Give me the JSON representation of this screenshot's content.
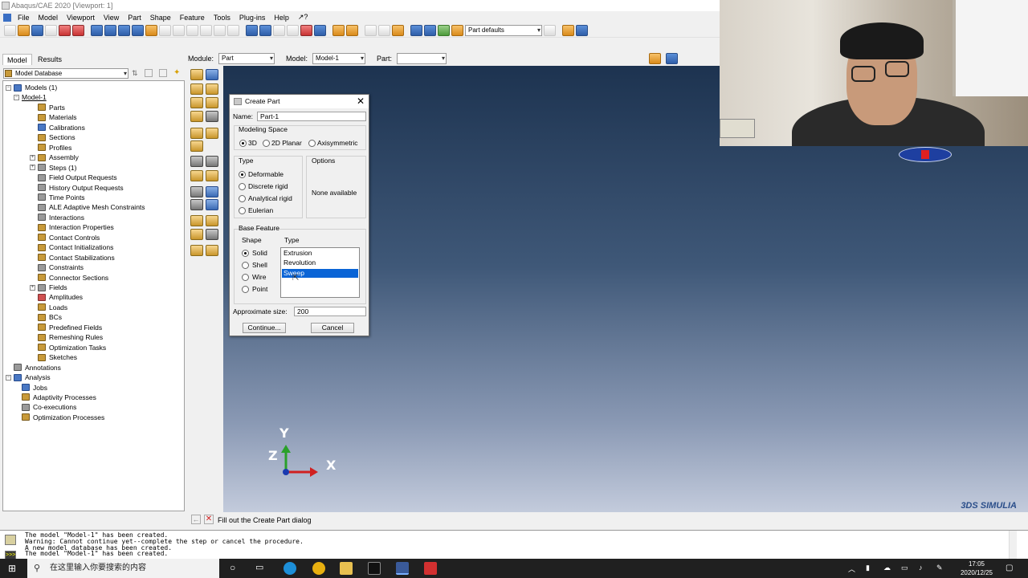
{
  "window": {
    "title": "Abaqus/CAE 2020 [Viewport: 1]"
  },
  "menu": [
    "File",
    "Model",
    "Viewport",
    "View",
    "Part",
    "Shape",
    "Feature",
    "Tools",
    "Plug-ins",
    "Help",
    "↗?"
  ],
  "toolbar": {
    "part_defaults": "Part defaults"
  },
  "tree_tabs": [
    "Model",
    "Results"
  ],
  "context": {
    "module_label": "Module:",
    "module_value": "Part",
    "model_label": "Model:",
    "model_value": "Model-1",
    "part_label": "Part:",
    "part_value": ""
  },
  "tree_combo": "Model Database",
  "tree": [
    {
      "label": "Models (1)",
      "indent": 0,
      "exp": "−",
      "icon": "blue"
    },
    {
      "label": "Model-1",
      "indent": 1,
      "exp": "−",
      "icon": "none",
      "underline": true
    },
    {
      "label": "Parts",
      "indent": 2,
      "icon": "orange"
    },
    {
      "label": "Materials",
      "indent": 2,
      "icon": "orange"
    },
    {
      "label": "Calibrations",
      "indent": 2,
      "icon": "blue"
    },
    {
      "label": "Sections",
      "indent": 2,
      "icon": "orange"
    },
    {
      "label": "Profiles",
      "indent": 2,
      "icon": "orange"
    },
    {
      "label": "Assembly",
      "indent": 2,
      "exp": "+",
      "icon": "orange"
    },
    {
      "label": "Steps (1)",
      "indent": 2,
      "exp": "+",
      "icon": "gray"
    },
    {
      "label": "Field Output Requests",
      "indent": 2,
      "icon": "gray"
    },
    {
      "label": "History Output Requests",
      "indent": 2,
      "icon": "gray"
    },
    {
      "label": "Time Points",
      "indent": 2,
      "icon": "gray"
    },
    {
      "label": "ALE Adaptive Mesh Constraints",
      "indent": 2,
      "icon": "gray"
    },
    {
      "label": "Interactions",
      "indent": 2,
      "icon": "gray"
    },
    {
      "label": "Interaction Properties",
      "indent": 2,
      "icon": "orange"
    },
    {
      "label": "Contact Controls",
      "indent": 2,
      "icon": "orange"
    },
    {
      "label": "Contact Initializations",
      "indent": 2,
      "icon": "orange"
    },
    {
      "label": "Contact Stabilizations",
      "indent": 2,
      "icon": "orange"
    },
    {
      "label": "Constraints",
      "indent": 2,
      "icon": "gray"
    },
    {
      "label": "Connector Sections",
      "indent": 2,
      "icon": "orange"
    },
    {
      "label": "Fields",
      "indent": 2,
      "exp": "+",
      "icon": "gray"
    },
    {
      "label": "Amplitudes",
      "indent": 2,
      "icon": "red"
    },
    {
      "label": "Loads",
      "indent": 2,
      "icon": "orange"
    },
    {
      "label": "BCs",
      "indent": 2,
      "icon": "orange"
    },
    {
      "label": "Predefined Fields",
      "indent": 2,
      "icon": "orange"
    },
    {
      "label": "Remeshing Rules",
      "indent": 2,
      "icon": "orange"
    },
    {
      "label": "Optimization Tasks",
      "indent": 2,
      "icon": "orange"
    },
    {
      "label": "Sketches",
      "indent": 2,
      "icon": "orange"
    },
    {
      "label": "Annotations",
      "indent": 0,
      "icon": "gray"
    },
    {
      "label": "Analysis",
      "indent": 0,
      "exp": "−",
      "icon": "blue"
    },
    {
      "label": "Jobs",
      "indent": 1,
      "icon": "blue"
    },
    {
      "label": "Adaptivity Processes",
      "indent": 1,
      "icon": "orange"
    },
    {
      "label": "Co-executions",
      "indent": 1,
      "icon": "gray"
    },
    {
      "label": "Optimization Processes",
      "indent": 1,
      "icon": "orange"
    }
  ],
  "dialog": {
    "title": "Create Part",
    "name_label": "Name:",
    "name_value": "Part-1",
    "modeling_space_label": "Modeling Space",
    "space_options": [
      "3D",
      "2D Planar",
      "Axisymmetric"
    ],
    "type_label": "Type",
    "type_options": [
      "Deformable",
      "Discrete rigid",
      "Analytical rigid",
      "Eulerian"
    ],
    "options_label": "Options",
    "options_value": "None available",
    "base_feature_label": "Base Feature",
    "shape_label": "Shape",
    "shape_options": [
      "Solid",
      "Shell",
      "Wire",
      "Point"
    ],
    "feature_type_label": "Type",
    "feature_types": [
      "Extrusion",
      "Revolution",
      "Sweep"
    ],
    "approx_label": "Approximate size:",
    "approx_value": "200",
    "continue_label": "Continue...",
    "cancel_label": "Cancel"
  },
  "triad": {
    "y": "Y",
    "z": "Z",
    "x": "X"
  },
  "prompt": {
    "text": "Fill out the Create Part dialog"
  },
  "brand": "3DS SIMULIA",
  "messages": [
    "The model \"Model-1\" has been created.",
    "Warning: Cannot continue yet--complete the step or cancel the procedure.",
    "A new model database has been created.",
    "The model \"Model-1\" has been created."
  ],
  "taskbar": {
    "search_placeholder": "在这里输入你要搜索的内容",
    "time": "17:05",
    "date": "2020/12/25"
  }
}
